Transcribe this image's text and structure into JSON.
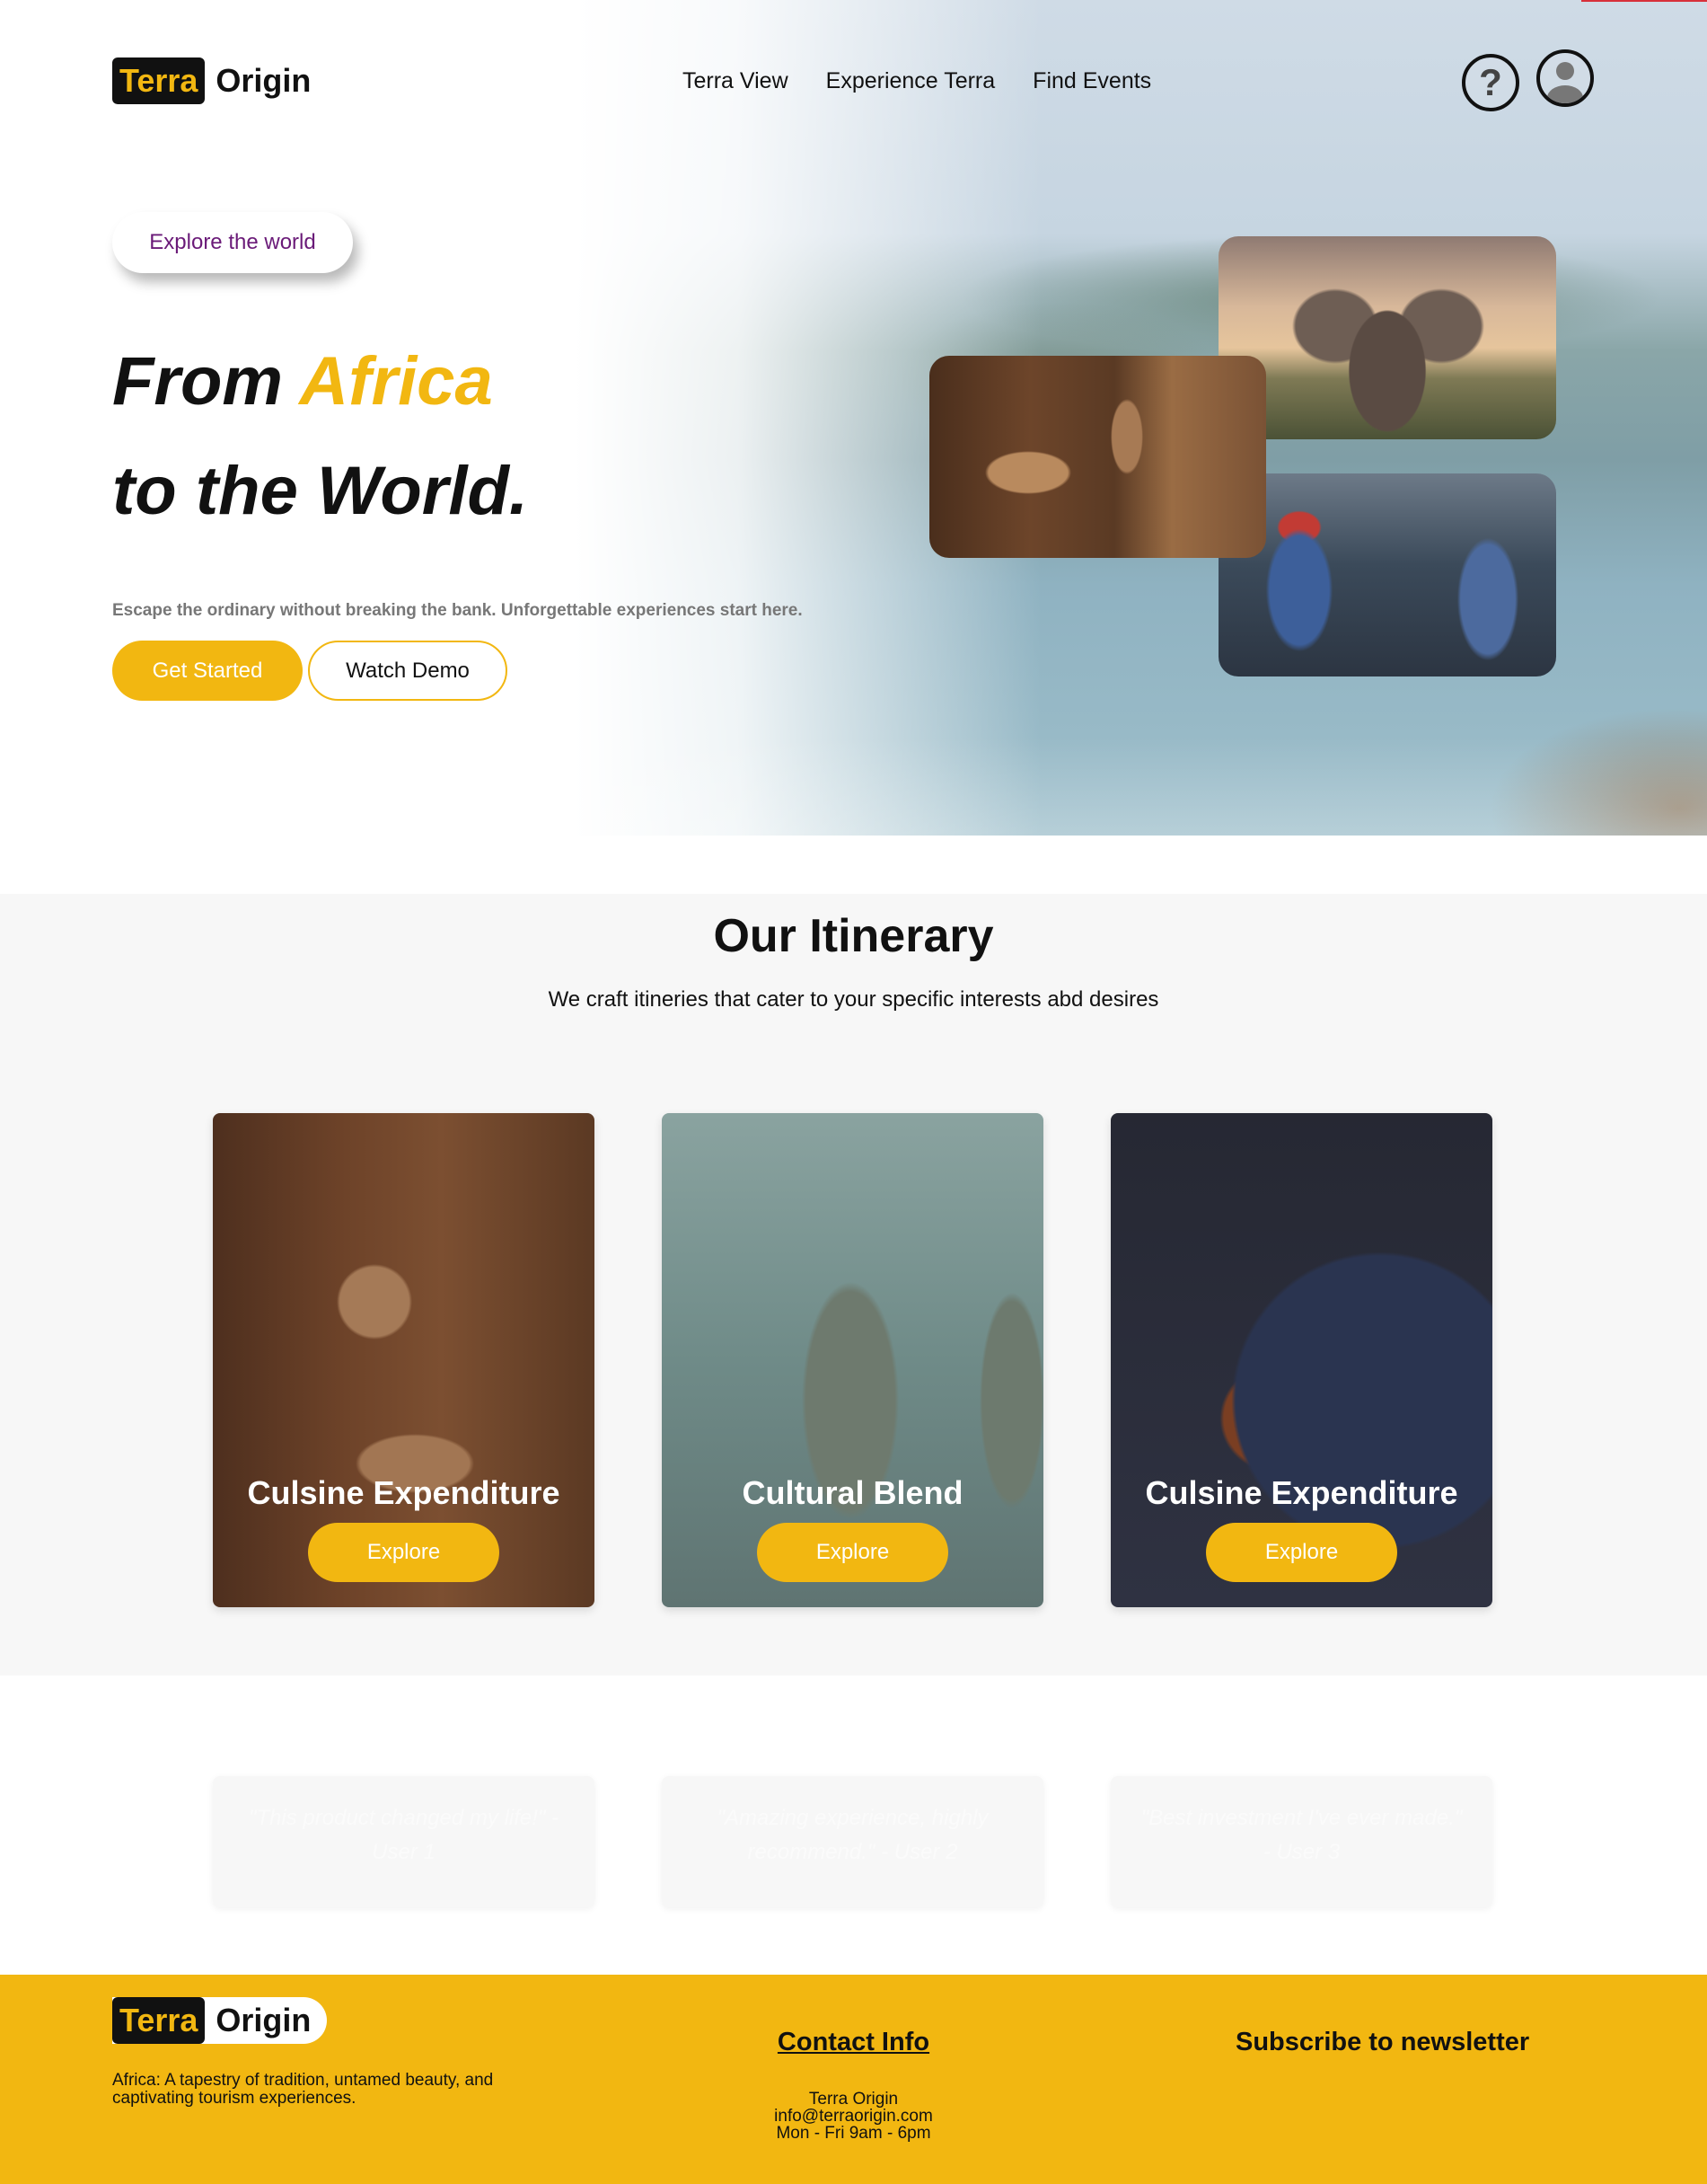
{
  "brand": {
    "logo_box": "Terra",
    "logo_text": "Origin"
  },
  "nav": {
    "items": [
      "Terra View",
      "Experience Terra",
      "Find Events"
    ]
  },
  "hero": {
    "pill": "Explore the world",
    "headline_1a": "From ",
    "headline_1b": "Africa",
    "headline_2": "to the World.",
    "subtitle": "Escape the ordinary without breaking the bank. Unforgettable experiences start here.",
    "btn_primary": "Get Started",
    "btn_secondary": "Watch Demo",
    "help_icon": "?"
  },
  "itinerary": {
    "title": "Our Itinerary",
    "subtitle": "We craft itineries that cater to your specific interests abd desires",
    "cards": [
      {
        "title": "Culsine Expenditure",
        "button": "Explore"
      },
      {
        "title": "Cultural Blend",
        "button": "Explore"
      },
      {
        "title": "Culsine Expenditure",
        "button": "Explore"
      }
    ]
  },
  "testimonials": [
    "\"This product changed my life!\" - User 1",
    "\"Amazing experience, highly recommend.\" - User 2",
    "\"Best investment I've ever made.\" - User 3"
  ],
  "footer": {
    "description": "Africa: A tapestry of tradition, untamed beauty, and captivating tourism experiences.",
    "contact_title": "Contact Info",
    "contact_name": "Terra Origin",
    "contact_email": "info@terraorigin.com",
    "contact_hours": "Mon - Fri 9am - 6pm",
    "newsletter_title": "Subscribe to newsletter"
  },
  "colors": {
    "accent": "#f2b711",
    "dark": "#111111",
    "pill_text": "#6a1a78",
    "section_bg": "#f7f7f7"
  },
  "icons": {
    "help": "help-icon",
    "user": "user-avatar-icon"
  }
}
